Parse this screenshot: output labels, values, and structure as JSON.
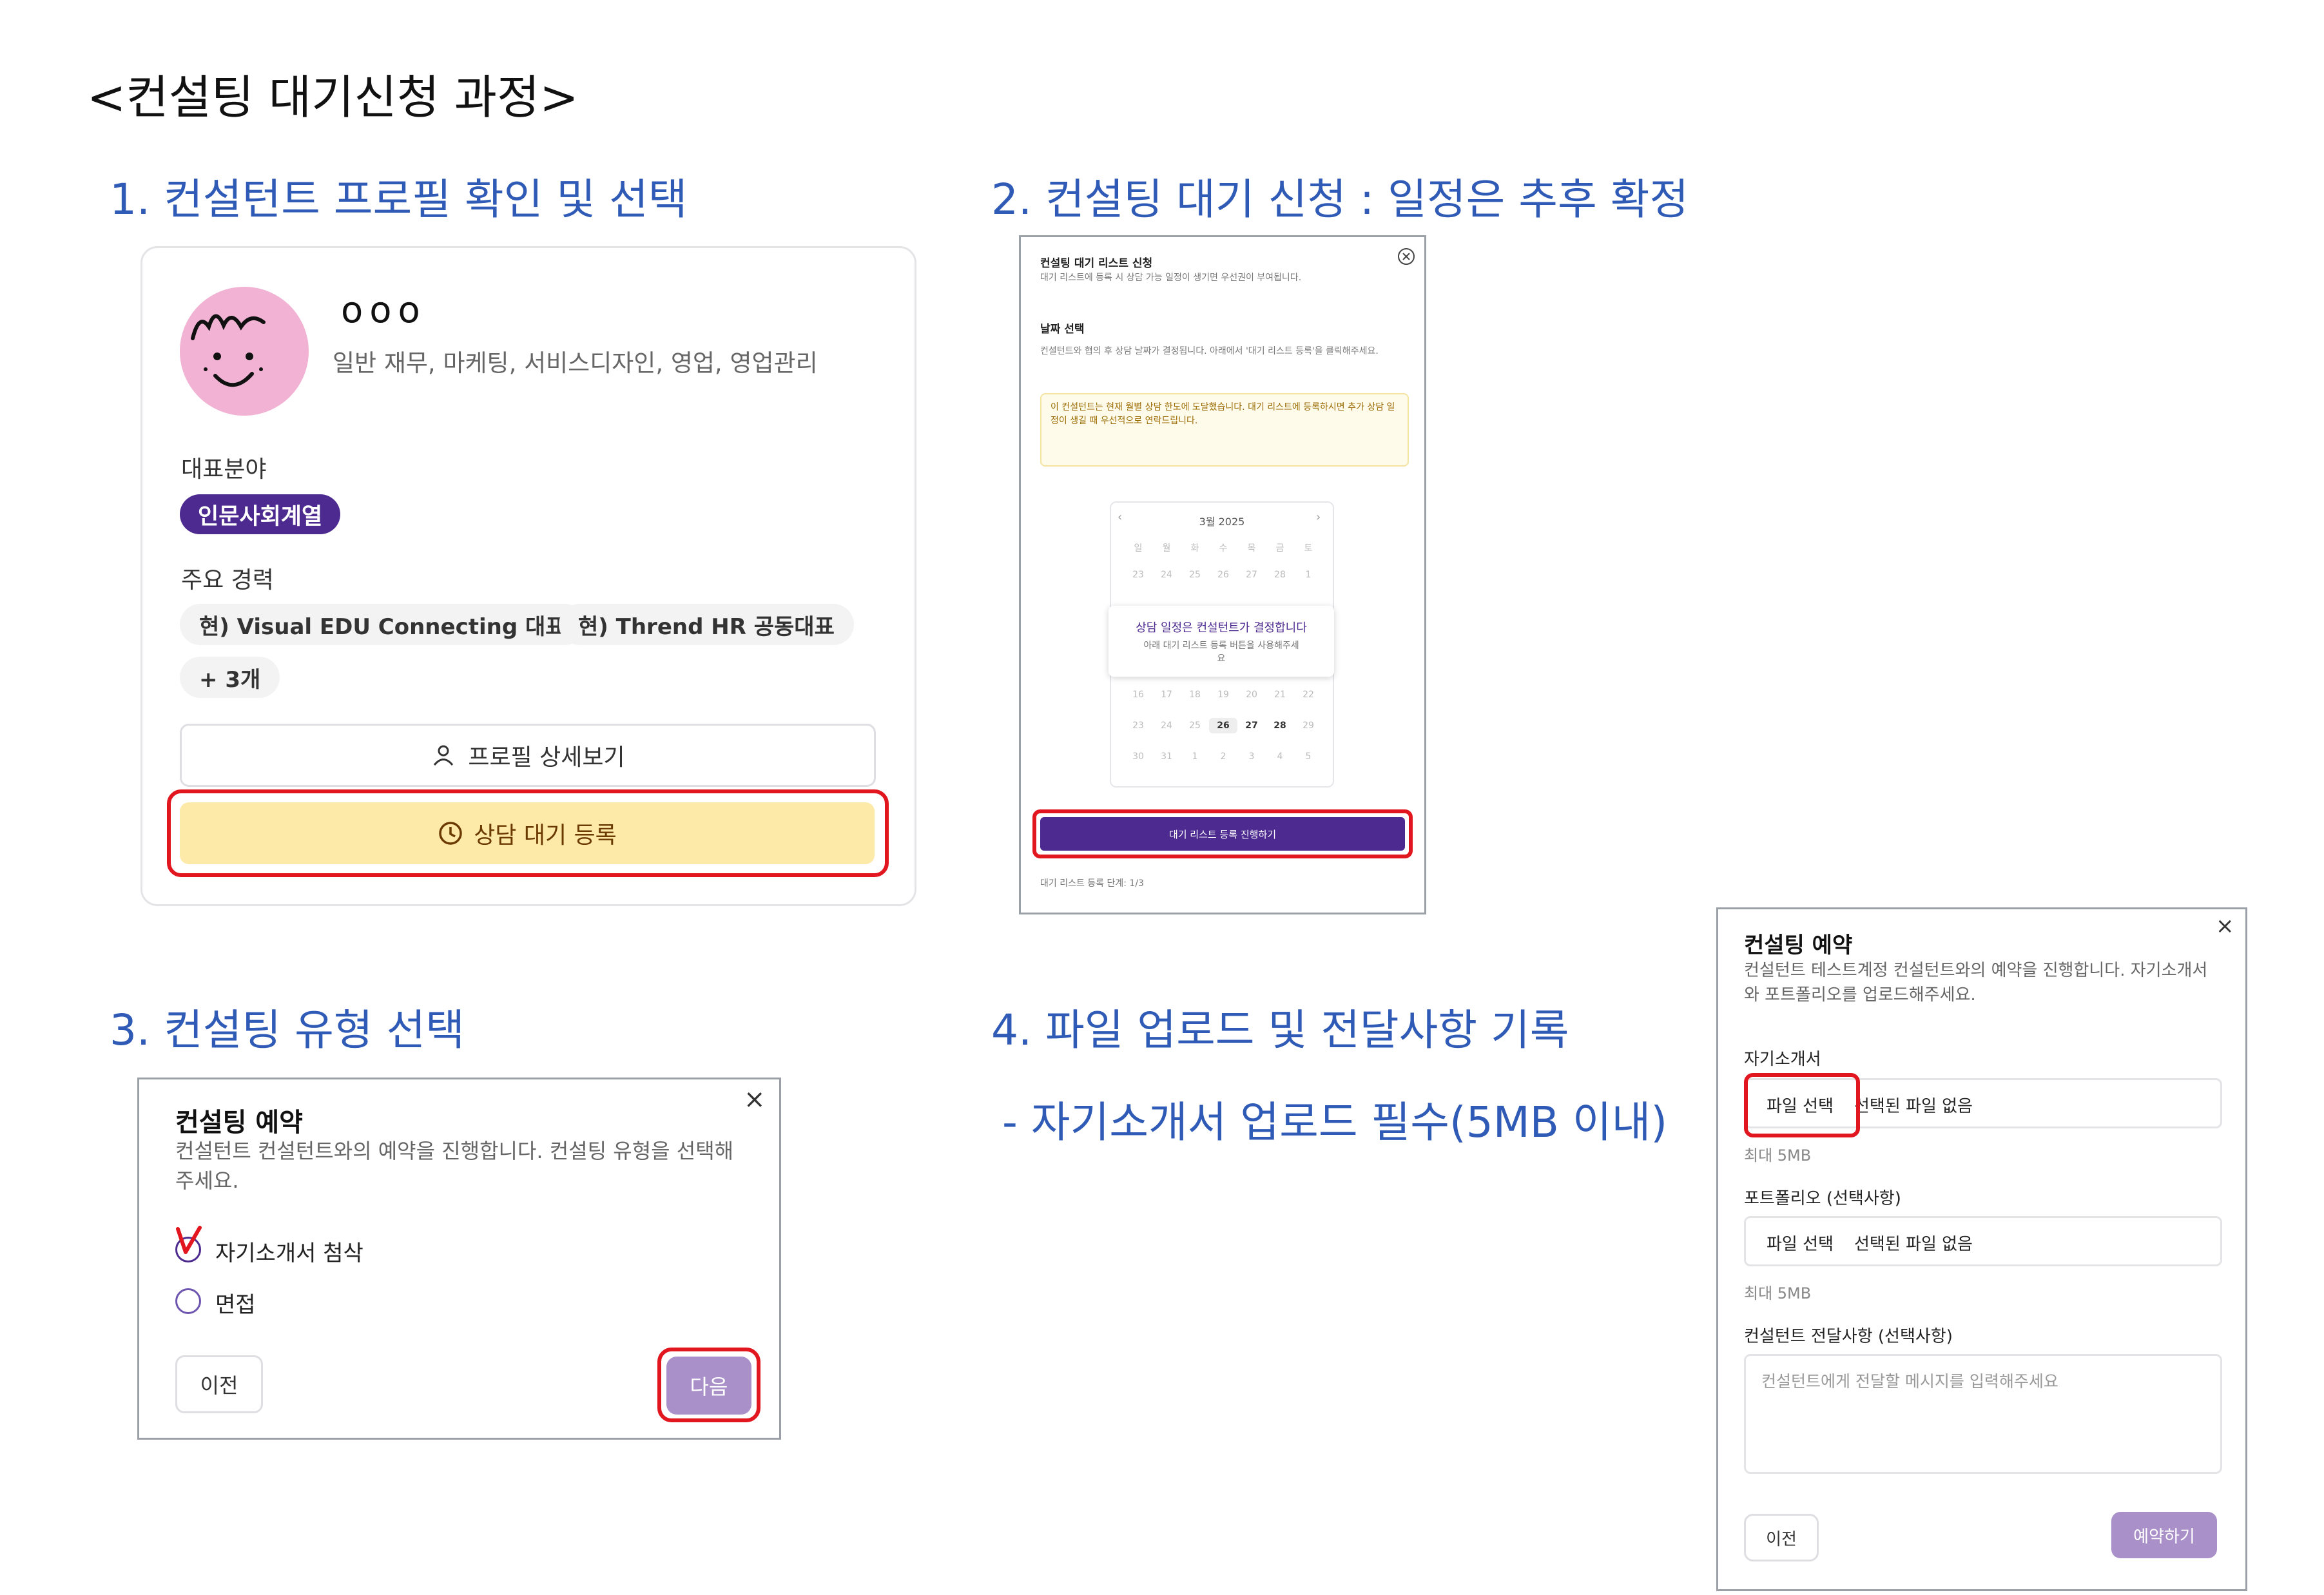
{
  "page_title": "<컨설팅 대기신청 과정>",
  "steps": {
    "s1": "1. 컨설턴트 프로필 확인 및 선택",
    "s2": "2. 컨설팅 대기 신청 : 일정은 추후 확정",
    "s3": "3. 컨설팅 유형 선택",
    "s4": "4. 파일 업로드 및 전달사항 기록",
    "s4_note": "- 자기소개서 업로드 필수(5MB 이내)"
  },
  "profile": {
    "name": "ooo",
    "fields": "일반 재무, 마케팅, 서비스디자인, 영업, 영업관리",
    "rep_label": "대표분야",
    "rep_badge": "인문사회계열",
    "career_label": "주요 경력",
    "career": [
      "현) Visual EDU Connecting 대표",
      "현) Thrend HR 공동대표",
      "+ 3개"
    ],
    "detail_button": "프로필 상세보기",
    "wait_button": "상담 대기 등록"
  },
  "waitlist_modal": {
    "title": "컨설팅 대기 리스트 신청",
    "subtitle": "대기 리스트에 등록 시 상담 가능 일정이 생기면 우선권이 부여됩니다.",
    "date_heading": "날짜 선택",
    "date_desc": "컨설턴트와 협의 후 상담 날짜가 결정됩니다. 아래에서 '대기 리스트 등록'을 클릭해주세요.",
    "notice": "이 컨설턴트는 현재 월별 상담 한도에 도달했습니다. 대기 리스트에 등록하시면 추가 상담 일정이 생길 때 우선적으로 연락드립니다.",
    "month": "3월 2025",
    "weekdays": [
      "일",
      "월",
      "화",
      "수",
      "목",
      "금",
      "토"
    ],
    "weeks": [
      [
        "23",
        "24",
        "25",
        "26",
        "27",
        "28",
        "1"
      ],
      [
        "16",
        "17",
        "18",
        "19",
        "20",
        "21",
        "22"
      ],
      [
        "23",
        "24",
        "25",
        "26",
        "27",
        "28",
        "29"
      ],
      [
        "30",
        "31",
        "1",
        "2",
        "3",
        "4",
        "5"
      ]
    ],
    "overlay_title": "상담 일정은 컨설턴트가 결정합니다",
    "overlay_desc": "아래 대기 리스트 등록 버튼을 사용해주세요",
    "submit": "대기 리스트 등록 진행하기",
    "progress": "대기 리스트 등록 단계: 1/3"
  },
  "type_modal": {
    "title": "컨설팅 예약",
    "desc": "컨설턴트 컨설턴트와의 예약을 진행합니다. 컨설팅 유형을 선택해주세요.",
    "options": [
      "자기소개서 첨삭",
      "면접"
    ],
    "prev": "이전",
    "next": "다음"
  },
  "upload_modal": {
    "title": "컨설팅 예약",
    "desc": "컨설턴트 테스트계정 컨설턴트와의 예약을 진행합니다. 자기소개서와 포트폴리오를 업로드해주세요.",
    "resume_label": "자기소개서",
    "choose_file": "파일 선택",
    "no_file": "선택된 파일 없음",
    "max_size": "최대 5MB",
    "portfolio_label": "포트폴리오 (선택사항)",
    "message_label": "컨설턴트 전달사항 (선택사항)",
    "message_placeholder": "컨설턴트에게 전달할 메시지를 입력해주세요",
    "prev": "이전",
    "submit": "예약하기"
  },
  "colors": {
    "step_blue": "#2f5bb7",
    "purple": "#4c2a8f",
    "light_purple": "#a990c8",
    "yellow": "#fde9a8",
    "red_highlight": "#e1161e"
  }
}
